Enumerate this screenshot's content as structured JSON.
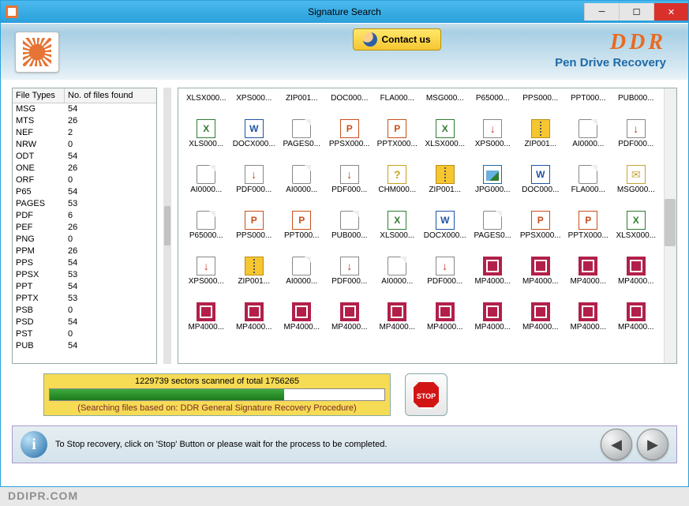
{
  "window": {
    "title": "Signature Search"
  },
  "header": {
    "contact_label": "Contact us",
    "brand_title": "DDR",
    "brand_sub": "Pen Drive Recovery"
  },
  "type_table": {
    "col1": "File Types",
    "col2": "No. of files found",
    "rows": [
      {
        "t": "MSG",
        "n": "54"
      },
      {
        "t": "MTS",
        "n": "26"
      },
      {
        "t": "NEF",
        "n": "2"
      },
      {
        "t": "NRW",
        "n": "0"
      },
      {
        "t": "ODT",
        "n": "54"
      },
      {
        "t": "ONE",
        "n": "26"
      },
      {
        "t": "ORF",
        "n": "0"
      },
      {
        "t": "P65",
        "n": "54"
      },
      {
        "t": "PAGES",
        "n": "53"
      },
      {
        "t": "PDF",
        "n": "6"
      },
      {
        "t": "PEF",
        "n": "26"
      },
      {
        "t": "PNG",
        "n": "0"
      },
      {
        "t": "PPM",
        "n": "26"
      },
      {
        "t": "PPS",
        "n": "54"
      },
      {
        "t": "PPSX",
        "n": "53"
      },
      {
        "t": "PPT",
        "n": "54"
      },
      {
        "t": "PPTX",
        "n": "53"
      },
      {
        "t": "PSB",
        "n": "0"
      },
      {
        "t": "PSD",
        "n": "54"
      },
      {
        "t": "PST",
        "n": "0"
      },
      {
        "t": "PUB",
        "n": "54"
      }
    ]
  },
  "files": {
    "row0": [
      "XLSX000...",
      "XPS000...",
      "ZIP001...",
      "DOC000...",
      "FLA000...",
      "MSG000...",
      "P65000...",
      "PPS000...",
      "PPT000...",
      "PUB000..."
    ],
    "row1": [
      {
        "l": "XLS000...",
        "k": "xls"
      },
      {
        "l": "DOCX000...",
        "k": "word"
      },
      {
        "l": "PAGES0...",
        "k": "doc"
      },
      {
        "l": "PPSX000...",
        "k": "ppt"
      },
      {
        "l": "PPTX000...",
        "k": "ppt"
      },
      {
        "l": "XLSX000...",
        "k": "xls"
      },
      {
        "l": "XPS000...",
        "k": "pdf"
      },
      {
        "l": "ZIP001...",
        "k": "zip"
      },
      {
        "l": "AI0000...",
        "k": "doc"
      },
      {
        "l": "PDF000...",
        "k": "pdf"
      }
    ],
    "row2": [
      {
        "l": "AI0000...",
        "k": "doc"
      },
      {
        "l": "PDF000...",
        "k": "pdf"
      },
      {
        "l": "AI0000...",
        "k": "doc"
      },
      {
        "l": "PDF000...",
        "k": "pdf"
      },
      {
        "l": "CHM000...",
        "k": "chm"
      },
      {
        "l": "ZIP001...",
        "k": "zip"
      },
      {
        "l": "JPG000...",
        "k": "img"
      },
      {
        "l": "DOC000...",
        "k": "word"
      },
      {
        "l": "FLA000...",
        "k": "doc"
      },
      {
        "l": "MSG000...",
        "k": "msg"
      }
    ],
    "row3": [
      {
        "l": "P65000...",
        "k": "doc"
      },
      {
        "l": "PPS000...",
        "k": "ppt"
      },
      {
        "l": "PPT000...",
        "k": "ppt"
      },
      {
        "l": "PUB000...",
        "k": "doc"
      },
      {
        "l": "XLS000...",
        "k": "xls"
      },
      {
        "l": "DOCX000...",
        "k": "word"
      },
      {
        "l": "PAGES0...",
        "k": "doc"
      },
      {
        "l": "PPSX000...",
        "k": "ppt"
      },
      {
        "l": "PPTX000...",
        "k": "ppt"
      },
      {
        "l": "XLSX000...",
        "k": "xls"
      }
    ],
    "row4": [
      {
        "l": "XPS000...",
        "k": "pdf"
      },
      {
        "l": "ZIP001...",
        "k": "zip"
      },
      {
        "l": "AI0000...",
        "k": "doc"
      },
      {
        "l": "PDF000...",
        "k": "pdf"
      },
      {
        "l": "AI0000...",
        "k": "doc"
      },
      {
        "l": "PDF000...",
        "k": "pdf"
      },
      {
        "l": "MP4000...",
        "k": "media"
      },
      {
        "l": "MP4000...",
        "k": "media"
      },
      {
        "l": "MP4000...",
        "k": "media"
      },
      {
        "l": "MP4000...",
        "k": "media"
      }
    ],
    "row5": [
      {
        "l": "MP4000...",
        "k": "media"
      },
      {
        "l": "MP4000...",
        "k": "media"
      },
      {
        "l": "MP4000...",
        "k": "media"
      },
      {
        "l": "MP4000...",
        "k": "media"
      },
      {
        "l": "MP4000...",
        "k": "media"
      },
      {
        "l": "MP4000...",
        "k": "media"
      },
      {
        "l": "MP4000...",
        "k": "media"
      },
      {
        "l": "MP4000...",
        "k": "media"
      },
      {
        "l": "MP4000...",
        "k": "media"
      },
      {
        "l": "MP4000...",
        "k": "media"
      }
    ]
  },
  "progress": {
    "top": "1229739 sectors scanned of total 1756265",
    "percent": 70,
    "sub": "(Searching files based on:  DDR General Signature Recovery Procedure)"
  },
  "info": {
    "text": "To Stop recovery, click on 'Stop' Button or please wait for the process to be completed."
  },
  "footer": {
    "text": "DDIPR.COM"
  }
}
